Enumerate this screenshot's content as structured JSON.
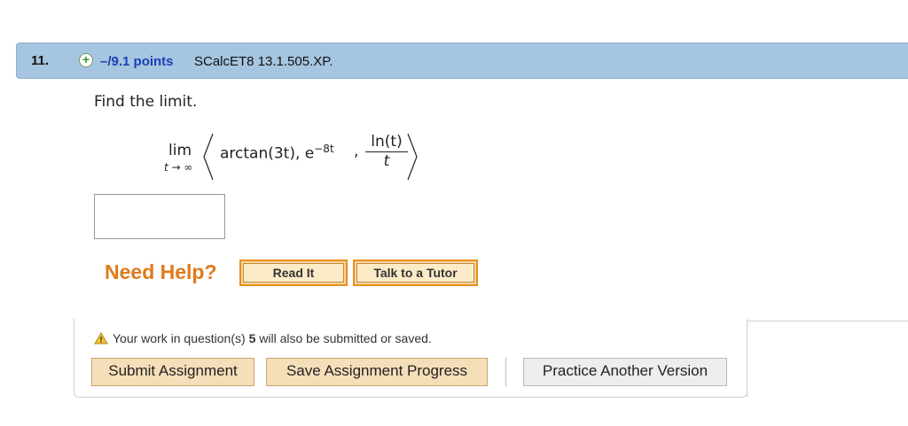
{
  "question": {
    "number": "11.",
    "points": "–/9.1 points",
    "reference": "SCalcET8 13.1.505.XP.",
    "prompt": "Find the limit.",
    "math": {
      "lim": "lim",
      "subscript": "t → ∞",
      "component1": "arctan(3t), e",
      "exponent": "−8t",
      "comma": ",",
      "numerator": "ln(t)",
      "denominator": "t"
    },
    "answer_value": ""
  },
  "help": {
    "label": "Need Help?",
    "read_it": "Read It",
    "talk_to_tutor": "Talk to a Tutor"
  },
  "notice": {
    "prefix": "Your work in question(s) ",
    "question_ref": "5",
    "suffix": " will also be submitted or saved."
  },
  "actions": {
    "submit": "Submit Assignment",
    "save": "Save Assignment Progress",
    "practice": "Practice Another Version"
  },
  "colors": {
    "header_bar": "#a6c5e1",
    "points_link": "#1b3fb6",
    "help_orange": "#e07a1c",
    "button_tan": "#f5dfb9"
  }
}
